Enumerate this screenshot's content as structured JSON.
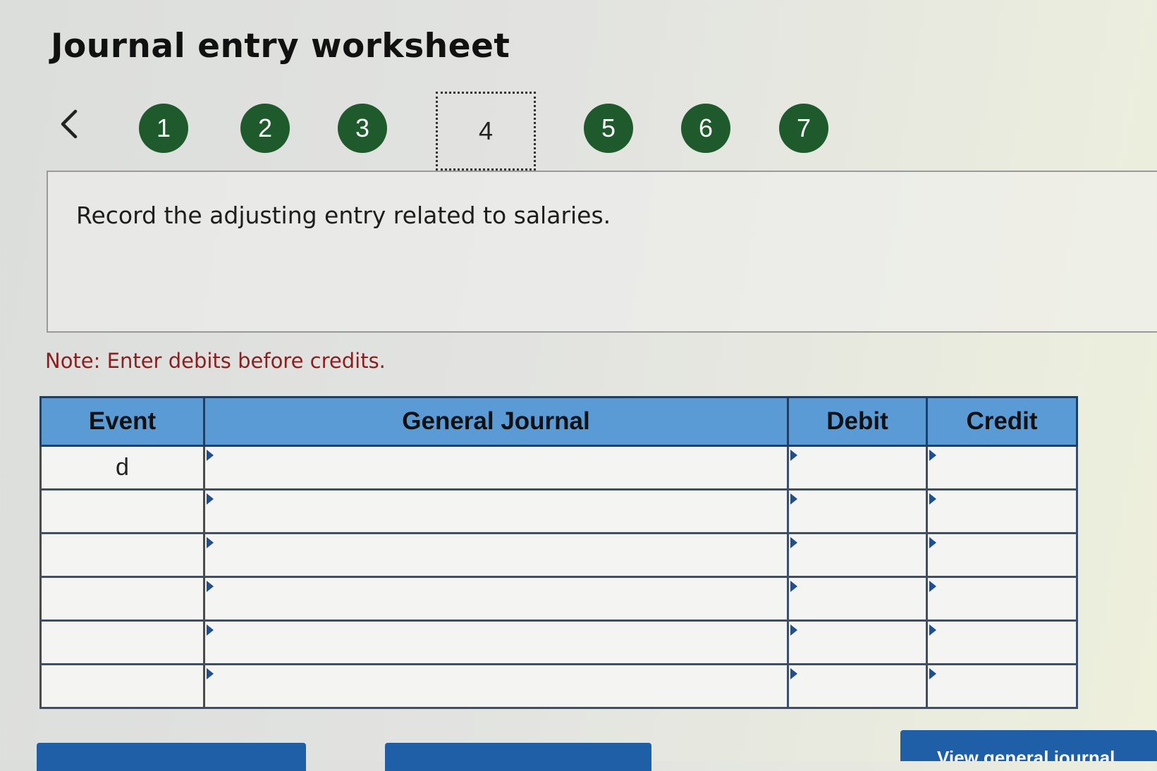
{
  "worksheet": {
    "title": "Journal entry worksheet",
    "nav": {
      "prev_icon": "chevron-left-icon",
      "steps": [
        "1",
        "2",
        "3",
        "4",
        "5",
        "6",
        "7"
      ],
      "current_step": "4",
      "step_color": "#1f5a2c"
    },
    "instruction": "Record the adjusting entry related to salaries.",
    "note": "Note: Enter debits before credits."
  },
  "journal": {
    "headers": {
      "event": "Event",
      "general_journal": "General Journal",
      "debit": "Debit",
      "credit": "Credit"
    },
    "header_color": "#5b9bd5",
    "rows": [
      {
        "event": "d",
        "account": "",
        "debit": "",
        "credit": ""
      },
      {
        "event": "",
        "account": "",
        "debit": "",
        "credit": ""
      },
      {
        "event": "",
        "account": "",
        "debit": "",
        "credit": ""
      },
      {
        "event": "",
        "account": "",
        "debit": "",
        "credit": ""
      },
      {
        "event": "",
        "account": "",
        "debit": "",
        "credit": ""
      },
      {
        "event": "",
        "account": "",
        "debit": "",
        "credit": ""
      }
    ]
  },
  "buttons": {
    "view_general_journal": "View general journal",
    "color": "#1f5fa8"
  }
}
